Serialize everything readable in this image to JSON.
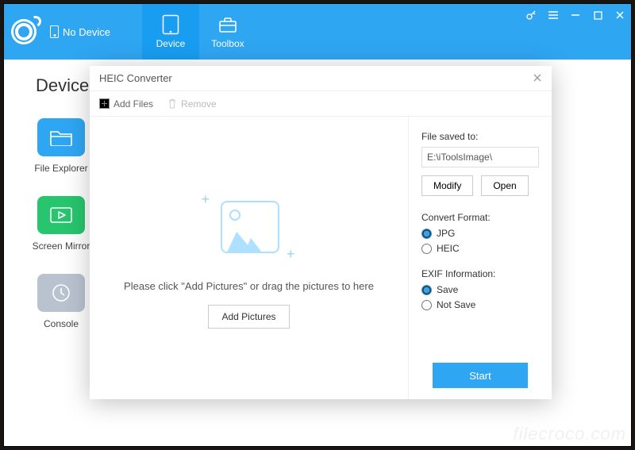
{
  "titlebar": {
    "no_device_label": "No Device",
    "nav": {
      "device": "Device",
      "toolbox": "Toolbox"
    },
    "active_tab": "device"
  },
  "main": {
    "heading": "Device",
    "tiles": [
      {
        "label": "File Explorer",
        "color": "blue"
      },
      {
        "label": "Screen Mirror",
        "color": "green"
      },
      {
        "label": "Console",
        "color": "gray"
      }
    ]
  },
  "modal": {
    "title": "HEIC Converter",
    "toolbar": {
      "add_files": "Add Files",
      "remove": "Remove"
    },
    "dropzone": {
      "hint": "Please click \"Add Pictures\" or drag the pictures to here",
      "button": "Add Pictures"
    },
    "sidebar": {
      "saved_to_label": "File saved to:",
      "saved_to_path": "E:\\iToolsImage\\",
      "modify": "Modify",
      "open": "Open",
      "format_label": "Convert Format:",
      "format_options": [
        "JPG",
        "HEIC"
      ],
      "format_selected": "JPG",
      "exif_label": "EXIF Information:",
      "exif_options": [
        "Save",
        "Not Save"
      ],
      "exif_selected": "Save",
      "start": "Start"
    }
  },
  "watermark": "filecroco.com",
  "colors": {
    "accent": "#2fa6f2"
  }
}
